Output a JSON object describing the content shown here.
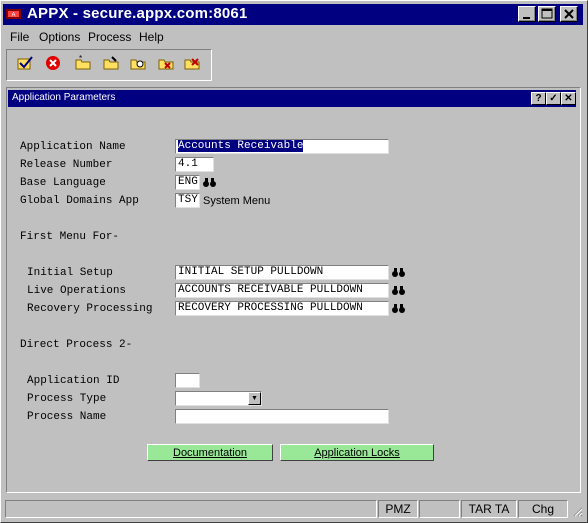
{
  "window": {
    "title": "APPX - secure.appx.com:8061",
    "minimize_icon": "minimize-icon",
    "maximize_icon": "maximize-icon",
    "close_icon": "close-icon"
  },
  "menubar": {
    "items": [
      {
        "label": "File"
      },
      {
        "label": "Options"
      },
      {
        "label": "Process"
      },
      {
        "label": "Help"
      }
    ]
  },
  "toolbar": {
    "icons": [
      "ok-check-icon",
      "cancel-icon",
      "add-folder-icon",
      "change-folder-icon",
      "inquire-folder-icon",
      "delete-folder-icon",
      "folder-check-icon"
    ]
  },
  "dialog": {
    "title": "Application Parameters",
    "help_label": "?",
    "ok_label": "✓",
    "close_label": "✕"
  },
  "form": {
    "app_name_label": "Application Name",
    "app_name_value": "Accounts Receivable",
    "release_label": "Release Number",
    "release_value": "4.1",
    "base_lang_label": "Base Language",
    "base_lang_value": "ENG",
    "global_domains_label": "Global Domains App",
    "global_domains_value": "TSY",
    "global_domains_desc": "System Menu",
    "first_menu_label": "First Menu For-",
    "initial_setup_label": "Initial Setup",
    "initial_setup_value": "INITIAL SETUP PULLDOWN",
    "live_ops_label": "Live Operations",
    "live_ops_value": "ACCOUNTS RECEIVABLE PULLDOWN",
    "recovery_label": "Recovery Processing",
    "recovery_value": "RECOVERY PROCESSING PULLDOWN",
    "direct_process_label": "Direct Process 2-",
    "app_id_label": "Application ID",
    "app_id_value": "",
    "process_type_label": "Process Type",
    "process_type_value": "",
    "process_name_label": "Process Name",
    "process_name_value": ""
  },
  "buttons": {
    "documentation": "Documentation",
    "application_locks": "Application Locks"
  },
  "statusbar": {
    "pmz": "PMZ",
    "tar_ta": "TAR TA",
    "mode": "Chg"
  },
  "colors": {
    "titlebar": "#000080",
    "button_green": "#98e898",
    "window_bg": "#c0c0c0"
  }
}
